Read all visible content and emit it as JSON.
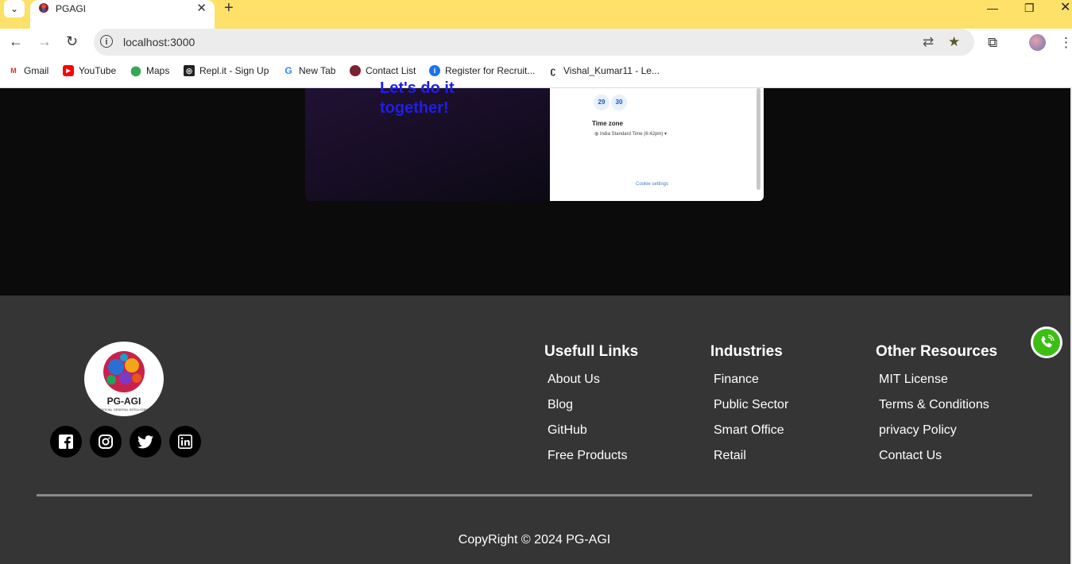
{
  "browser": {
    "tab_title": "PGAGI",
    "new_tab_symbol": "+",
    "url": "localhost:3000",
    "bookmarks": [
      {
        "label": "Gmail",
        "icon": "gmail-icon"
      },
      {
        "label": "YouTube",
        "icon": "youtube-icon"
      },
      {
        "label": "Maps",
        "icon": "maps-icon"
      },
      {
        "label": "Repl.it - Sign Up",
        "icon": "replit-icon"
      },
      {
        "label": "New Tab",
        "icon": "google-icon"
      },
      {
        "label": "Contact List",
        "icon": "pgagi-favicon-icon"
      },
      {
        "label": "Register for Recruit...",
        "icon": "info-icon"
      },
      {
        "label": "Vishal_Kumar11 - Le...",
        "icon": "leetcode-icon"
      }
    ]
  },
  "promo": {
    "text": "Let's do it together!"
  },
  "calendar": {
    "days": [
      "29",
      "30"
    ],
    "timezone_label": "Time zone",
    "timezone_value": "India Standard Time (6:42pm) ▾",
    "cookie_link": "Cookie settings"
  },
  "footer": {
    "logo_text": "PG-AGI",
    "logo_sub": "ARTIFICIAL GENERAL INTELLIGENCE",
    "social": [
      "facebook-icon",
      "instagram-icon",
      "twitter-icon",
      "linkedin-icon"
    ],
    "columns": [
      {
        "heading": "Usefull Links",
        "links": [
          "About Us",
          "Blog",
          "GitHub",
          "Free Products"
        ]
      },
      {
        "heading": "Industries",
        "links": [
          "Finance",
          "Public Sector",
          "Smart Office",
          "Retail"
        ]
      },
      {
        "heading": "Other Resources",
        "links": [
          "MIT License",
          "Terms & Conditions",
          "privacy Policy",
          "Contact Us"
        ]
      }
    ],
    "copyright": "CopyRight © 2024 PG-AGI"
  },
  "colors": {
    "tab_bar": "#fde168",
    "footer_bg": "#353535",
    "promo_text": "#1f1ee8",
    "phone_green": "#3cbf14"
  }
}
